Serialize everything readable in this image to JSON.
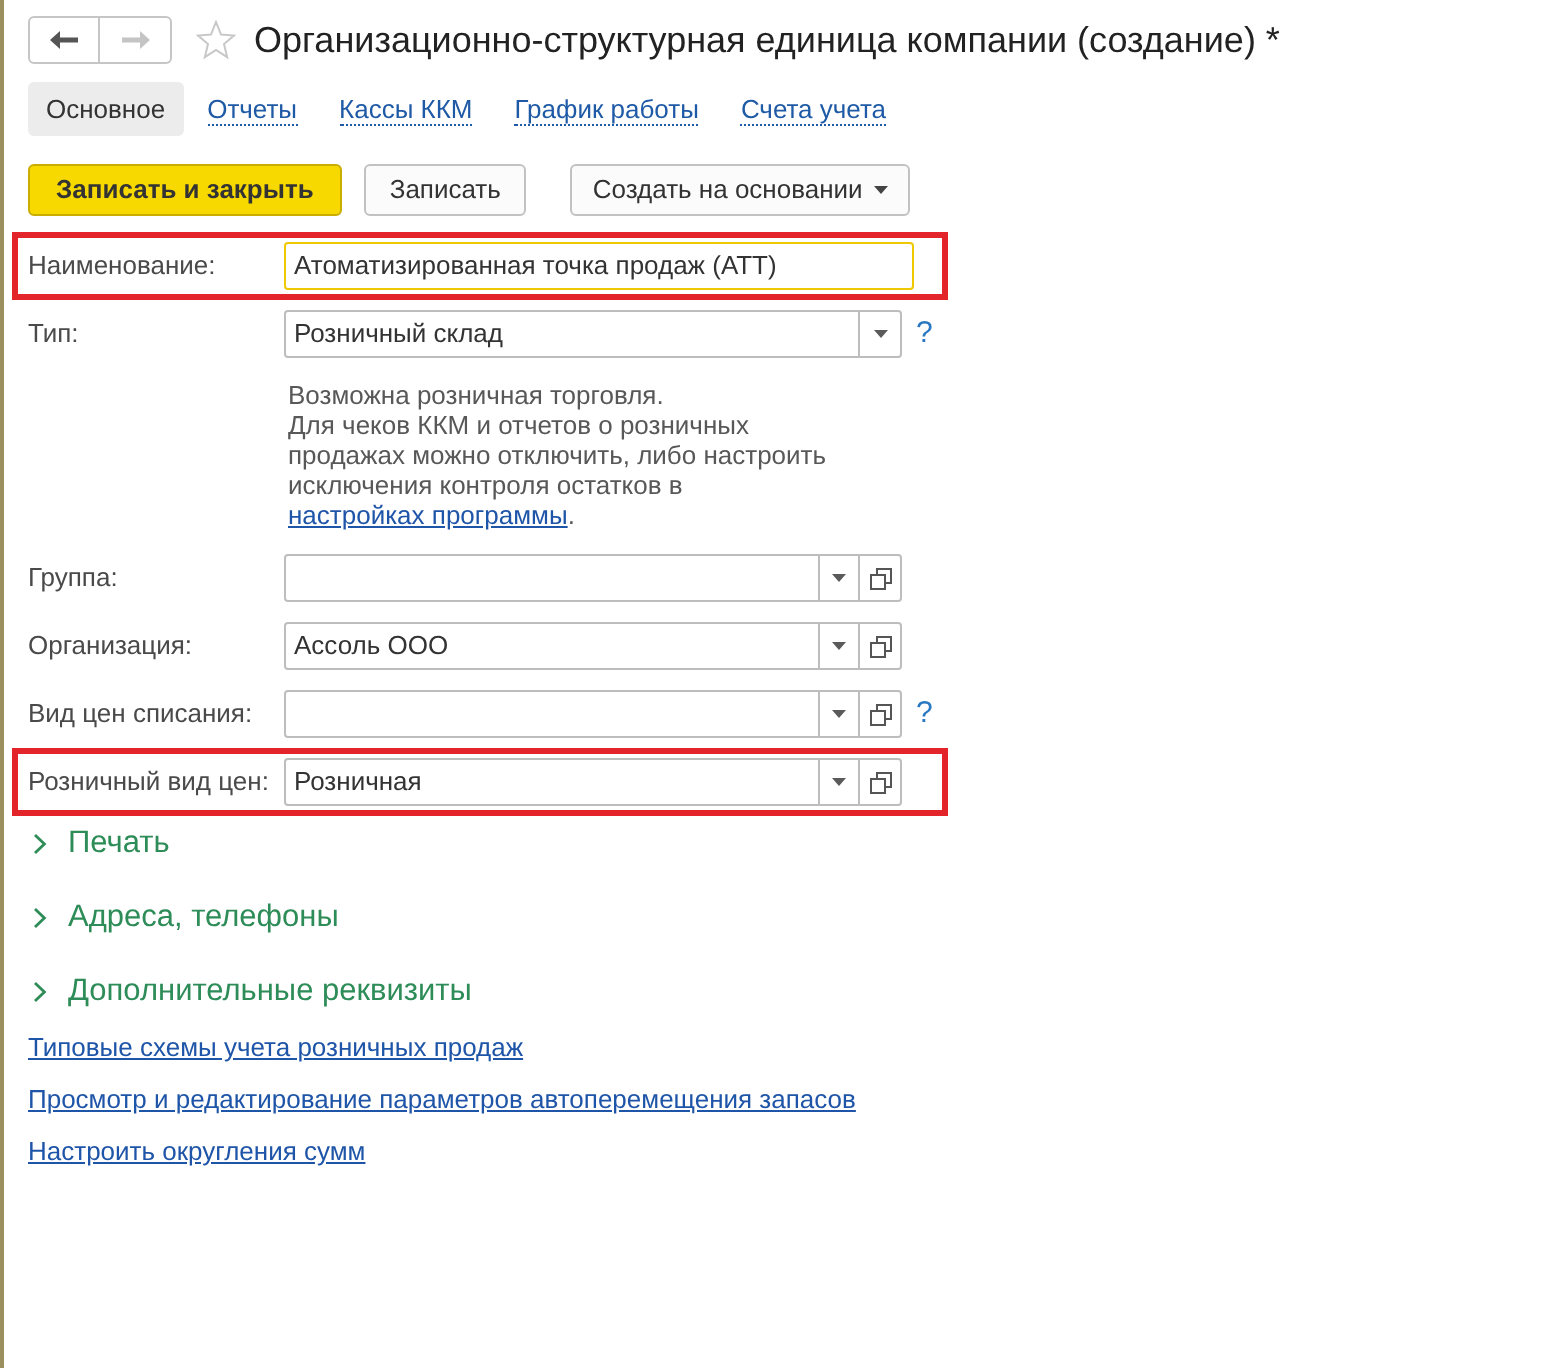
{
  "window": {
    "title": "Организационно-структурная единица компании (создание) *",
    "back_enabled": true,
    "forward_enabled": false,
    "favorite": false
  },
  "tabs": [
    {
      "label": "Основное",
      "selected": true
    },
    {
      "label": "Отчеты",
      "selected": false
    },
    {
      "label": "Кассы ККМ",
      "selected": false
    },
    {
      "label": "График работы",
      "selected": false
    },
    {
      "label": "Счета учета",
      "selected": false
    }
  ],
  "commands": [
    {
      "label": "Записать и закрыть",
      "kind": "primary"
    },
    {
      "label": "Записать",
      "kind": "plain"
    },
    {
      "label": "Создать на основании",
      "kind": "menu"
    }
  ],
  "fields": [
    {
      "label": "Наименование:",
      "kind": "text",
      "value": "Атоматизированная точка продаж (АТТ)",
      "focused": true,
      "highlighted": true
    },
    {
      "label": "Тип:",
      "kind": "combo",
      "value": "Розничный склад",
      "dropdown": true,
      "open_button": false,
      "help": "?",
      "focused": false,
      "highlighted": false,
      "note": {
        "text": "Возможна розничная торговля.\nДля чеков ККМ и отчетов о розничных продажах можно отключить, либо настроить исключения контроля остатков в",
        "link": "настройках программы",
        "tail": "."
      }
    },
    {
      "label": "Группа:",
      "kind": "combo",
      "dropdown": true,
      "open_button": true,
      "focused": false,
      "highlighted": false
    },
    {
      "label": "Организация:",
      "kind": "combo",
      "value": "Ассоль ООО",
      "dropdown": true,
      "open_button": true,
      "focused": false,
      "highlighted": false
    },
    {
      "label": "Вид цен списания:",
      "kind": "combo",
      "dropdown": true,
      "open_button": true,
      "help": "?",
      "focused": false,
      "highlighted": false
    },
    {
      "label": "Розничный вид цен:",
      "kind": "combo",
      "value": "Розничная",
      "dropdown": true,
      "open_button": true,
      "focused": false,
      "highlighted": true
    }
  ],
  "sections": [
    {
      "label": "Печать",
      "expanded": false
    },
    {
      "label": "Адреса, телефоны",
      "expanded": false
    },
    {
      "label": "Дополнительные реквизиты",
      "expanded": false
    }
  ],
  "links": [
    "Типовые схемы учета розничных продаж",
    "Просмотр и редактирование параметров автоперемещения запасов",
    "Настроить округления сумм"
  ]
}
